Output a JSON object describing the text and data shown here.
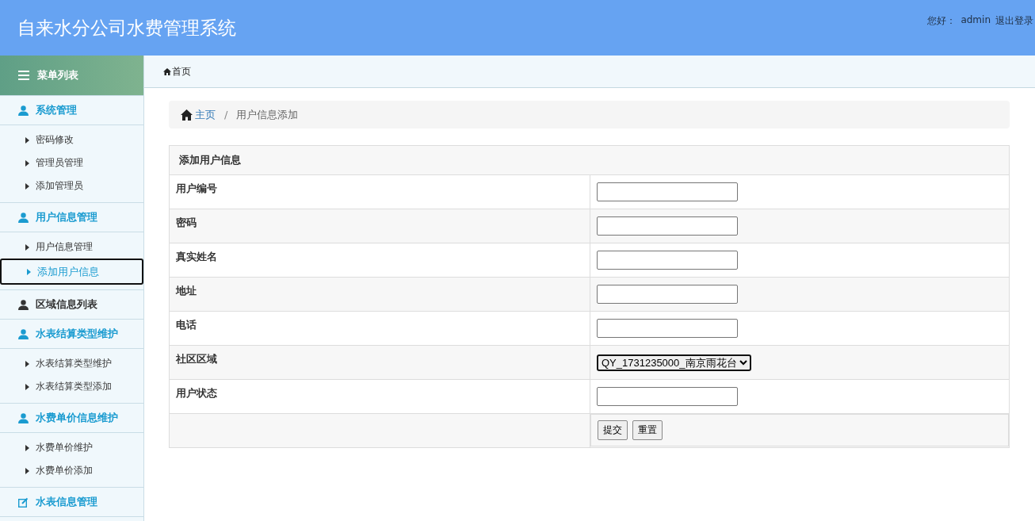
{
  "header": {
    "title": "自来水分公司水费管理系统",
    "greeting": "您好：",
    "user": "admin",
    "logout": "退出登录"
  },
  "sidebar": {
    "title": "菜单列表",
    "groups": [
      {
        "label": "系统管理",
        "kind": "folder",
        "items": [
          {
            "label": "密码修改",
            "selected": false
          },
          {
            "label": "管理员管理",
            "selected": false
          },
          {
            "label": "添加管理员",
            "selected": false
          }
        ]
      },
      {
        "label": "用户信息管理",
        "kind": "folder",
        "items": [
          {
            "label": "用户信息管理",
            "selected": false
          },
          {
            "label": "添加用户信息",
            "selected": true
          }
        ]
      },
      {
        "label": "区域信息列表",
        "kind": "link"
      },
      {
        "label": "水表结算类型维护",
        "kind": "folder",
        "items": [
          {
            "label": "水表结算类型维护",
            "selected": false
          },
          {
            "label": "水表结算类型添加",
            "selected": false
          }
        ]
      },
      {
        "label": "水费单价信息维护",
        "kind": "folder",
        "items": [
          {
            "label": "水费单价维护",
            "selected": false
          },
          {
            "label": "水费单价添加",
            "selected": false
          }
        ]
      },
      {
        "label": "水表信息管理",
        "kind": "edit"
      }
    ]
  },
  "topbar": {
    "home": "首页"
  },
  "breadcrumb": {
    "home": "主页",
    "separator": "/",
    "current": "用户信息添加"
  },
  "form": {
    "title": "添加用户信息",
    "rows": [
      {
        "label": "用户编号",
        "kind": "text"
      },
      {
        "label": "密码",
        "kind": "text"
      },
      {
        "label": "真实姓名",
        "kind": "text"
      },
      {
        "label": "地址",
        "kind": "text"
      },
      {
        "label": "电话",
        "kind": "text"
      },
      {
        "label": "社区区域",
        "kind": "select",
        "value": "QY_1731235000_南京雨花台"
      },
      {
        "label": "用户状态",
        "kind": "text"
      }
    ],
    "buttons": [
      "提交",
      "重置"
    ]
  }
}
